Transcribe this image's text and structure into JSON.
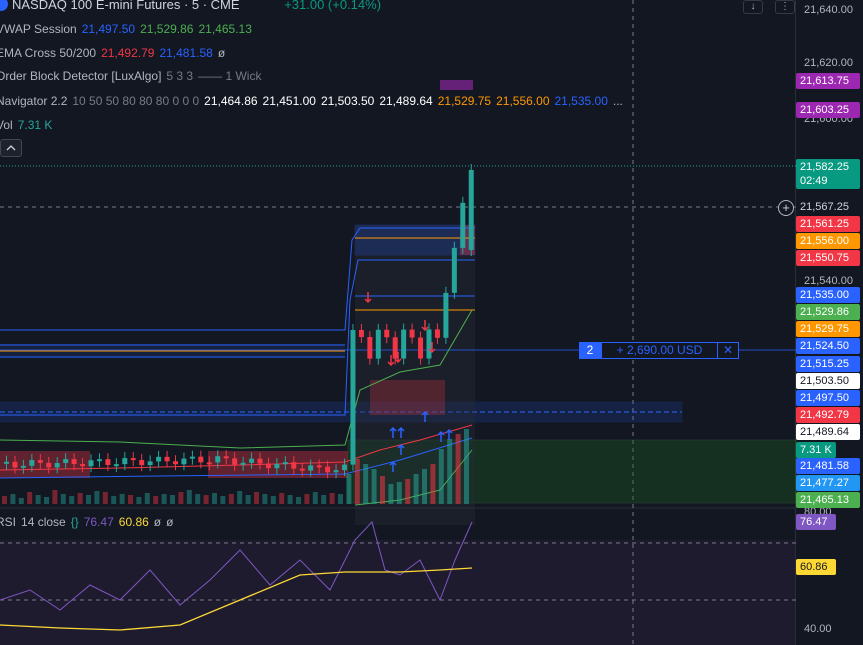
{
  "header": {
    "symbol_title": "NASDAQ 100 E-mini Futures · 5 · CME",
    "change": "+31.00 (+0.14%)"
  },
  "indicators": {
    "vwap": {
      "name": "VWAP Session",
      "v1": "21,497.50",
      "v2": "21,529.86",
      "v3": "21,465.13"
    },
    "ema": {
      "name": "EMA Cross 50/200",
      "v1": "21,492.79",
      "v2": "21,481.58",
      "v3": "ø"
    },
    "obd": {
      "name": "Order Block Detector [LuxAlgo]",
      "params": "5 3 3",
      "extra": "—— 1 Wick"
    },
    "nav": {
      "name": "Navigator 2.2",
      "params": "10 50 50 80 80 80 0 0 0",
      "v1": "21,464.86",
      "v2": "21,451.00",
      "v3": "21,503.50",
      "v4": "21,489.64",
      "v5": "21,529.75",
      "v6": "21,556.00",
      "v7": "21,535.00",
      "more": "..."
    },
    "vol": {
      "name": "Vol",
      "value": "7.31 K"
    },
    "rsi": {
      "name": "RSI",
      "params": "14 close",
      "v1": "76.47",
      "v2": "60.86",
      "v3": "ø",
      "v4": "ø"
    }
  },
  "price_axis": {
    "ticks": [
      "21,640.00",
      "21,620.00",
      "21,600.00",
      "21,540.00",
      "80.00",
      "40.00"
    ],
    "labels": [
      {
        "text": "21,613.75",
        "bg": "#9c27b0",
        "fg": "#ffffff"
      },
      {
        "text": "21,603.25",
        "bg": "#9c27b0",
        "fg": "#ffffff"
      },
      {
        "text": "21,582.25",
        "sub": "02:49",
        "bg": "#089981",
        "fg": "#ffffff"
      },
      {
        "text": "21,567.25",
        "bg": "#131722",
        "fg": "#d1d4dc"
      },
      {
        "text": "21,561.25",
        "bg": "#f23645",
        "fg": "#ffffff"
      },
      {
        "text": "21,556.00",
        "bg": "#ff9800",
        "fg": "#ffffff"
      },
      {
        "text": "21,550.75",
        "bg": "#f23645",
        "fg": "#ffffff"
      },
      {
        "text": "21,535.00",
        "bg": "#2962ff",
        "fg": "#ffffff"
      },
      {
        "text": "21,529.86",
        "bg": "#4caf50",
        "fg": "#ffffff"
      },
      {
        "text": "21,529.75",
        "bg": "#ff9800",
        "fg": "#ffffff"
      },
      {
        "text": "21,524.50",
        "bg": "#2962ff",
        "fg": "#ffffff"
      },
      {
        "text": "21,515.25",
        "bg": "#2962ff",
        "fg": "#ffffff"
      },
      {
        "text": "21,503.50",
        "bg": "#ffffff",
        "fg": "#131722"
      },
      {
        "text": "21,497.50",
        "bg": "#2962ff",
        "fg": "#ffffff"
      },
      {
        "text": "21,492.79",
        "bg": "#f23645",
        "fg": "#ffffff"
      },
      {
        "text": "21,489.64",
        "bg": "#ffffff",
        "fg": "#131722"
      },
      {
        "text": "7.31 K",
        "bg": "#089981",
        "fg": "#ffffff"
      },
      {
        "text": "21,481.58",
        "bg": "#2962ff",
        "fg": "#ffffff"
      },
      {
        "text": "21,477.27",
        "bg": "#2196f3",
        "fg": "#ffffff"
      },
      {
        "text": "21,465.13",
        "bg": "#4caf50",
        "fg": "#ffffff"
      },
      {
        "text": "76.47",
        "bg": "#7e57c2",
        "fg": "#ffffff"
      },
      {
        "text": "60.86",
        "bg": "#fdd835",
        "fg": "#131722"
      }
    ]
  },
  "position": {
    "qty": "2",
    "pnl": "+ 2,690.00 USD",
    "close": "✕"
  },
  "buttons": {
    "scroll_down": "↓",
    "more": "⋮",
    "collapse": "^",
    "crosshair_add": "+"
  },
  "colors": {
    "up": "#26a69a",
    "down": "#f23645",
    "accent": "#2962ff",
    "rsi_line": "#7e57c2",
    "rsi_ma": "#fdd835"
  }
}
